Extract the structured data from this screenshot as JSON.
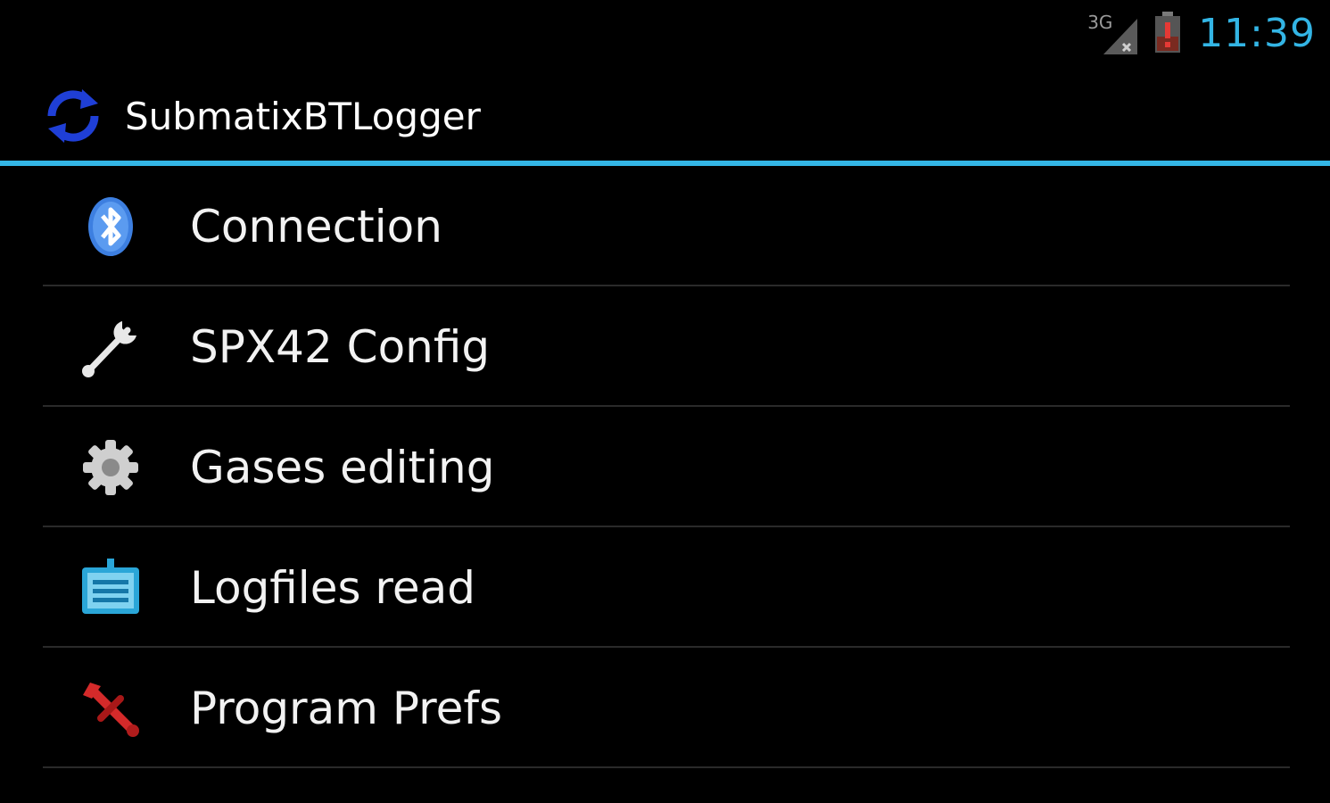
{
  "status_bar": {
    "network_type": "3G",
    "time": "11:39",
    "icons": [
      "signal-no-service-icon",
      "battery-low-icon"
    ]
  },
  "action_bar": {
    "app_icon": "sync-icon",
    "title": "SubmatixBTLogger"
  },
  "menu": {
    "items": [
      {
        "label": "Connection",
        "icon": "bluetooth-icon"
      },
      {
        "label": "SPX42 Config",
        "icon": "wrench-icon"
      },
      {
        "label": "Gases editing",
        "icon": "gear-icon"
      },
      {
        "label": "Logfiles read",
        "icon": "logbook-icon"
      },
      {
        "label": "Program Prefs",
        "icon": "tools-icon"
      }
    ]
  },
  "colors": {
    "accent": "#33b5e5",
    "background": "#000000",
    "text": "#f2f2f2",
    "battery_alert": "#d32f2f"
  }
}
